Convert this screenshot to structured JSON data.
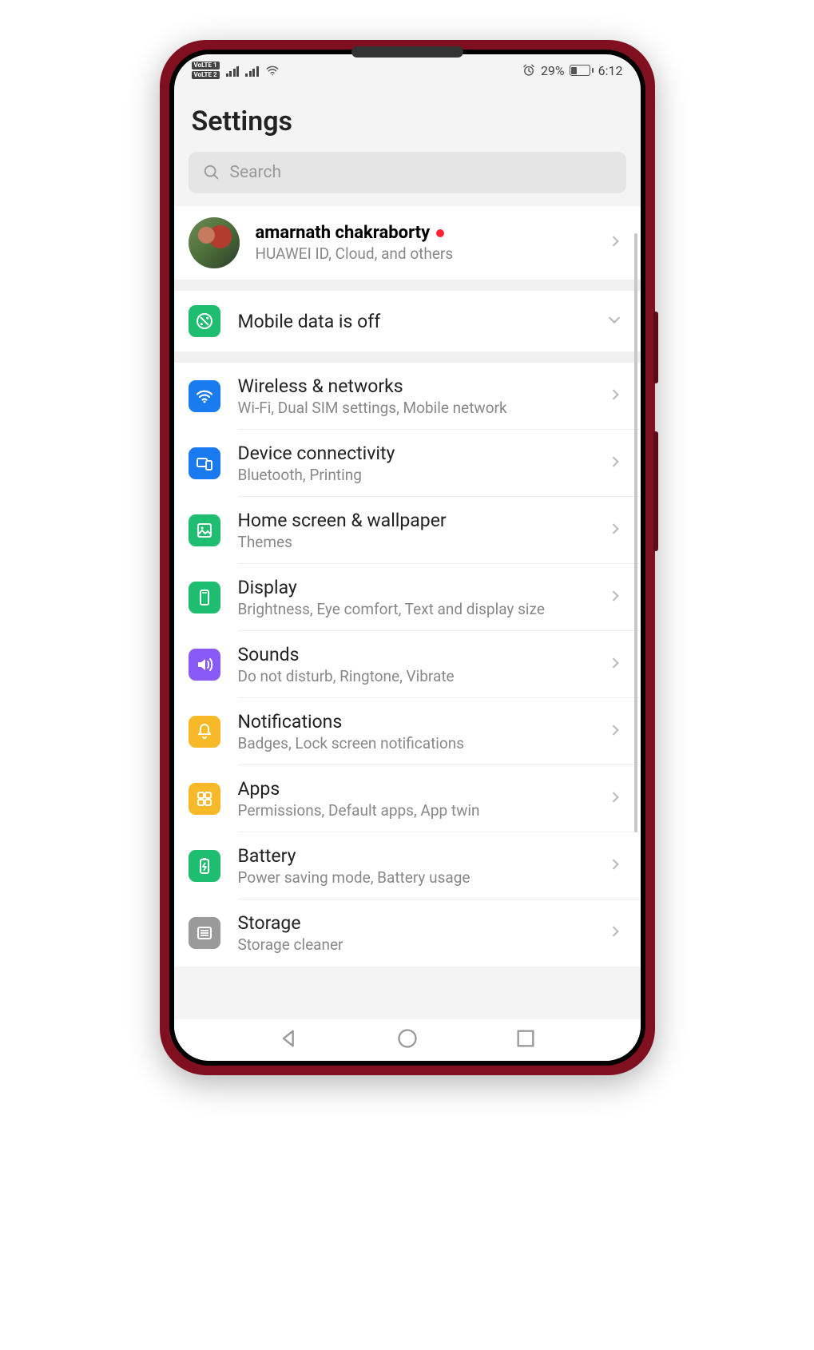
{
  "status_bar": {
    "volte1": "VoLTE 1",
    "volte2": "VoLTE 2",
    "battery_pct": "29%",
    "time": "6:12"
  },
  "header": {
    "title": "Settings"
  },
  "search": {
    "placeholder": "Search"
  },
  "account": {
    "name": "amarnath chakraborty",
    "subtitle": "HUAWEI ID, Cloud, and others"
  },
  "mobile_data": {
    "label": "Mobile data is off"
  },
  "items": [
    {
      "title": "Wireless & networks",
      "subtitle": "Wi-Fi, Dual SIM settings, Mobile network"
    },
    {
      "title": "Device connectivity",
      "subtitle": "Bluetooth, Printing"
    },
    {
      "title": "Home screen & wallpaper",
      "subtitle": "Themes"
    },
    {
      "title": "Display",
      "subtitle": "Brightness, Eye comfort, Text and display size"
    },
    {
      "title": "Sounds",
      "subtitle": "Do not disturb, Ringtone, Vibrate"
    },
    {
      "title": "Notifications",
      "subtitle": "Badges, Lock screen notifications"
    },
    {
      "title": "Apps",
      "subtitle": "Permissions, Default apps, App twin"
    },
    {
      "title": "Battery",
      "subtitle": "Power saving mode, Battery usage"
    },
    {
      "title": "Storage",
      "subtitle": "Storage cleaner"
    }
  ]
}
